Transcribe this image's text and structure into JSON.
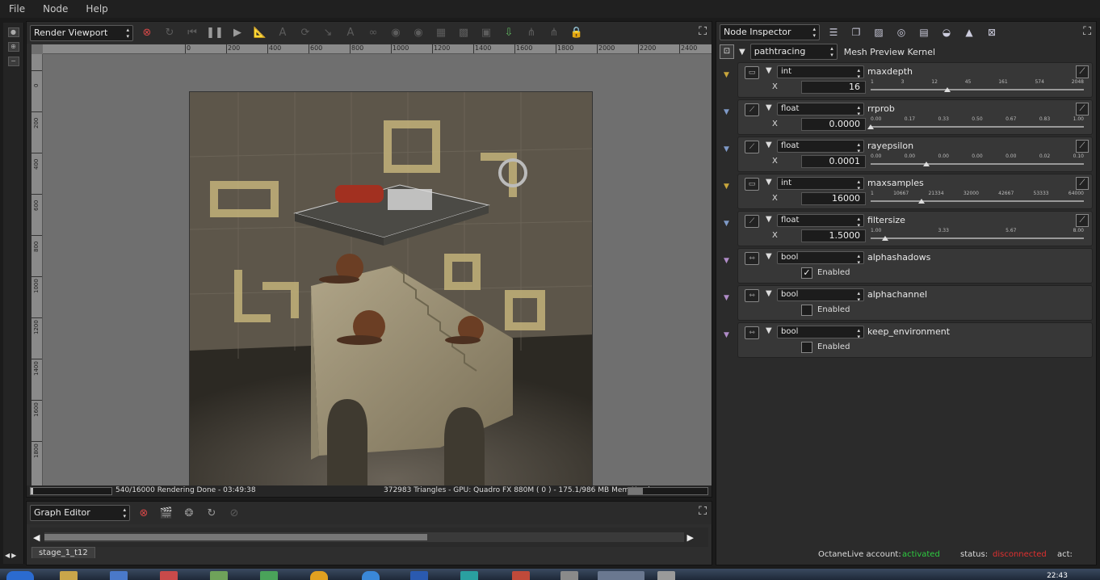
{
  "menu": {
    "file": "File",
    "node": "Node",
    "help": "Help"
  },
  "render_viewport": {
    "selector": "Render Viewport",
    "ruler_h": [
      "0",
      "200",
      "400",
      "600",
      "800",
      "1000",
      "1200",
      "1400",
      "1600",
      "1800",
      "2000",
      "2200",
      "2400"
    ],
    "ruler_v": [
      "0",
      "200",
      "400",
      "600",
      "800",
      "1000",
      "1200",
      "1400",
      "1600",
      "1800"
    ],
    "status_left": "540/16000 Rendering Done - 03:49:38",
    "status_right": "372983 Triangles - GPU: Quadro FX 880M ( 0 ) - 175.1/986 MB Mem Used",
    "progress_fraction": 0.034,
    "mem_fraction": 0.18
  },
  "graph_editor": {
    "selector": "Graph Editor",
    "tab": "stage_1_t12"
  },
  "node_inspector": {
    "selector": "Node Inspector",
    "kernel_type": "pathtracing",
    "kernel_label": "Mesh Preview Kernel",
    "params": [
      {
        "type": "int",
        "name": "maxdepth",
        "axis": "X",
        "value": "16",
        "ticks": [
          "1",
          "3",
          "12",
          "45",
          "161",
          "574",
          "2048"
        ],
        "pos": 0.36
      },
      {
        "type": "float",
        "name": "rrprob",
        "axis": "X",
        "value": "0.0000",
        "ticks": [
          "0.00",
          "0.17",
          "0.33",
          "0.50",
          "0.67",
          "0.83",
          "1.00"
        ],
        "pos": 0.0
      },
      {
        "type": "float",
        "name": "rayepsilon",
        "axis": "X",
        "value": "0.0001",
        "ticks": [
          "0.00",
          "0.00",
          "0.00",
          "0.00",
          "0.00",
          "0.02",
          "0.10"
        ],
        "pos": 0.26
      },
      {
        "type": "int",
        "name": "maxsamples",
        "axis": "X",
        "value": "16000",
        "ticks": [
          "1",
          "10667",
          "21334",
          "32000",
          "42667",
          "53333",
          "64000"
        ],
        "pos": 0.24
      },
      {
        "type": "float",
        "name": "filtersize",
        "axis": "X",
        "value": "1.5000",
        "ticks": [
          "1.00",
          "3.33",
          "5.67",
          "8.00"
        ],
        "pos": 0.07
      }
    ],
    "bools": [
      {
        "type": "bool",
        "name": "alphashadows",
        "label": "Enabled",
        "checked": true
      },
      {
        "type": "bool",
        "name": "alphachannel",
        "label": "Enabled",
        "checked": false
      },
      {
        "type": "bool",
        "name": "keep_environment",
        "label": "Enabled",
        "checked": false
      }
    ],
    "footer": {
      "account_label": "OctaneLive account:",
      "account_value": "activated",
      "status_label": "status:",
      "status_value": "disconnected",
      "act_label": "act:"
    }
  },
  "taskbar": {
    "clock": "22:43"
  },
  "colors": {
    "int_pin": "#c8a63c",
    "float_pin": "#7f9ac8",
    "bool_pin": "#b08cc8",
    "activated": "#2ecc40",
    "disconnected": "#e03030"
  }
}
